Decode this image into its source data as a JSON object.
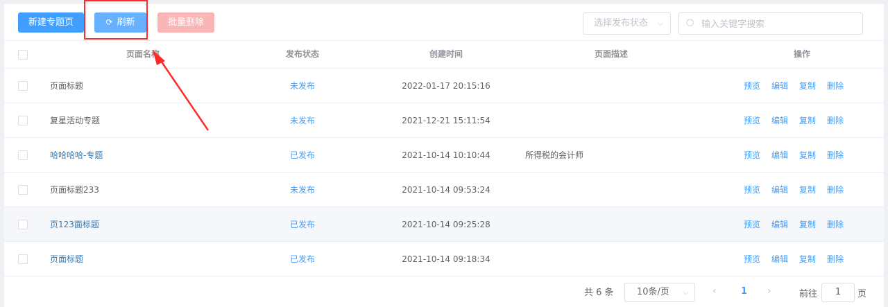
{
  "toolbar": {
    "new_label": "新建专题页",
    "refresh_label": "刷新",
    "batch_delete_label": "批量删除",
    "status_select_placeholder": "选择发布状态",
    "search_placeholder": "输入关键字搜索"
  },
  "table": {
    "headers": {
      "name": "页面名称",
      "status": "发布状态",
      "created": "创建时间",
      "desc": "页面描述",
      "actions": "操作"
    },
    "rows": [
      {
        "name": "页面标题",
        "status": "未发布",
        "created": "2022-01-17 20:15:16",
        "desc": ""
      },
      {
        "name": "复星活动专题",
        "status": "未发布",
        "created": "2021-12-21 15:11:54",
        "desc": ""
      },
      {
        "name": "哈哈哈哈-专题",
        "status": "已发布",
        "created": "2021-10-14 10:10:44",
        "desc": "所得税的会计师"
      },
      {
        "name": "页面标题233",
        "status": "未发布",
        "created": "2021-10-14 09:53:24",
        "desc": ""
      },
      {
        "name": "页123面标题",
        "status": "已发布",
        "created": "2021-10-14 09:25:28",
        "desc": ""
      },
      {
        "name": "页面标题",
        "status": "已发布",
        "created": "2021-10-14 09:18:34",
        "desc": ""
      }
    ],
    "actions": {
      "preview": "预览",
      "edit": "编辑",
      "copy": "复制",
      "delete": "删除"
    }
  },
  "pagination": {
    "total": "共 6 条",
    "page_size": "10条/页",
    "current_page": "1",
    "goto_label": "前往",
    "goto_value": "1",
    "page_suffix": "页"
  },
  "colors": {
    "primary": "#409eff",
    "danger_disabled": "#fab6b6",
    "highlight": "#ff2a2a"
  }
}
